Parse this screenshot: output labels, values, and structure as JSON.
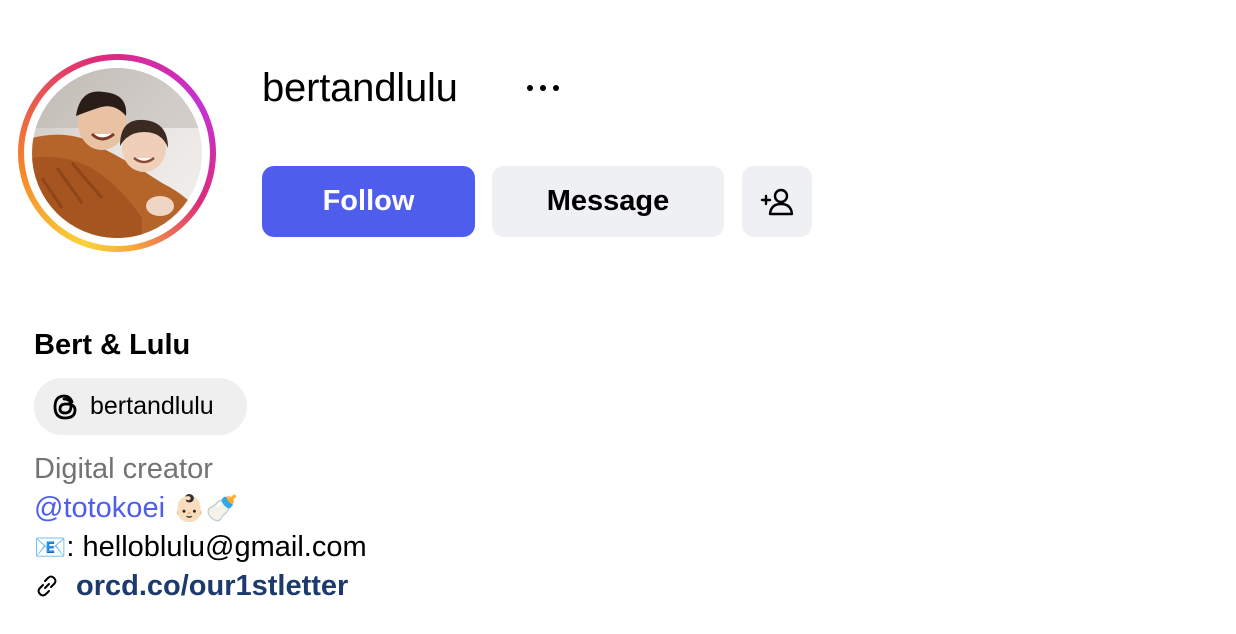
{
  "profile": {
    "username": "bertandlulu",
    "display_name": "Bert & Lulu",
    "threads_handle": "bertandlulu",
    "category": "Digital creator",
    "mention": "@totokoei",
    "mention_emoji": "👶🏻🍼",
    "email_prefix": "📧",
    "email_text": ": helloblulu@gmail.com",
    "link": "orcd.co/our1stletter"
  },
  "actions": {
    "follow_label": "Follow",
    "message_label": "Message"
  },
  "icons": {
    "more": "more-options-icon",
    "add_user": "add-person-icon",
    "threads": "threads-icon",
    "link": "link-icon",
    "email": "envelope-icon"
  },
  "colors": {
    "follow_bg": "#4f5ded",
    "secondary_bg": "#eff0f4",
    "mention": "#4f5ded",
    "link": "#1c3a6b",
    "muted": "#737373"
  }
}
